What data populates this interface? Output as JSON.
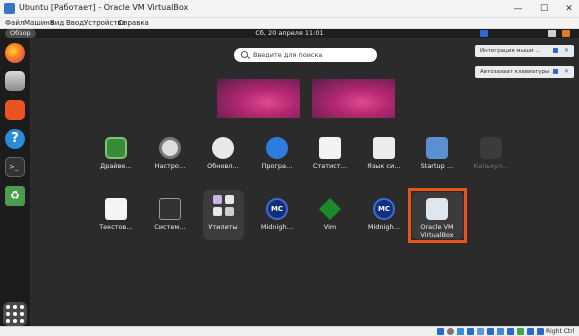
{
  "window": {
    "title": "Ubuntu [Работает] - Oracle VM VirtualBox",
    "minimize": "—",
    "maximize": "☐",
    "close": "✕"
  },
  "menu": {
    "items": [
      "Файл",
      "Машина",
      "Вид",
      "Ввод",
      "Устройства",
      "Справка"
    ]
  },
  "vm": {
    "overview_label": "Обзор",
    "clock": "Сб, 20 апреля  11:01",
    "search_placeholder": "Введите для поиска",
    "apps": [
      {
        "label": "Драйве…",
        "icon": "chip-icon"
      },
      {
        "label": "Настро…",
        "icon": "gear-icon"
      },
      {
        "label": "Обновл…",
        "icon": "update-icon"
      },
      {
        "label": "Програ…",
        "icon": "software-icon"
      },
      {
        "label": "Статист…",
        "icon": "stats-icon"
      },
      {
        "label": "Язык си…",
        "icon": "language-icon"
      },
      {
        "label": "Startup …",
        "icon": "startup-icon"
      },
      {
        "label": "Текстов…",
        "icon": "text-editor-icon"
      },
      {
        "label": "Систем…",
        "icon": "system-monitor-icon"
      },
      {
        "label": "Утилиты",
        "icon": "folder-grid-icon"
      },
      {
        "label": "Midnigh…",
        "icon": "mc-icon"
      },
      {
        "label": "Vim",
        "icon": "vim-icon"
      },
      {
        "label": "Midnigh…",
        "icon": "mc-icon"
      },
      {
        "label": "Oracle VM VirtualBox",
        "icon": "virtualbox-icon"
      }
    ],
    "ghost_app_label": "Калькул…",
    "mc_glyph": "MC",
    "notifications": [
      {
        "text": "Интеграция мыши …"
      },
      {
        "text": "Автозахват клавиатуры …"
      }
    ],
    "notif_close": "✕"
  },
  "statusbar": {
    "host_key": "Right Ctrl"
  },
  "colors": {
    "highlight": "#e8541e",
    "accent": "#e95420"
  }
}
